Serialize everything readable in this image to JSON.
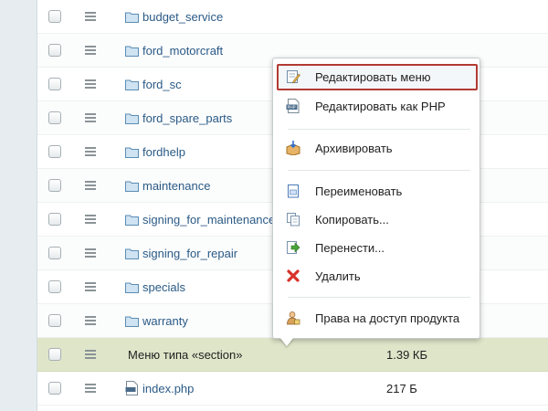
{
  "rows": [
    {
      "type": "folder",
      "name": "budget_service",
      "size": ""
    },
    {
      "type": "folder",
      "name": "ford_motorcraft",
      "size": ""
    },
    {
      "type": "folder",
      "name": "ford_sc",
      "size": ""
    },
    {
      "type": "folder",
      "name": "ford_spare_parts",
      "size": ""
    },
    {
      "type": "folder",
      "name": "fordhelp",
      "size": ""
    },
    {
      "type": "folder",
      "name": "maintenance",
      "size": ""
    },
    {
      "type": "folder",
      "name": "signing_for_maintenance",
      "size": ""
    },
    {
      "type": "folder",
      "name": "signing_for_repair",
      "size": ""
    },
    {
      "type": "folder",
      "name": "specials",
      "size": ""
    },
    {
      "type": "folder",
      "name": "warranty",
      "size": ""
    },
    {
      "type": "menu-file",
      "name": "Меню типа «section»",
      "size": "1.39 КБ"
    },
    {
      "type": "php-file",
      "name": "index.php",
      "size": "217 Б"
    }
  ],
  "context_menu": {
    "items": [
      {
        "label": "Редактировать меню",
        "icon": "edit-menu-icon"
      },
      {
        "label": "Редактировать как PHP",
        "icon": "php-icon"
      },
      {
        "label": "Архивировать",
        "icon": "archive-icon"
      },
      {
        "label": "Переименовать",
        "icon": "rename-icon"
      },
      {
        "label": "Копировать...",
        "icon": "copy-icon"
      },
      {
        "label": "Перенести...",
        "icon": "move-icon"
      },
      {
        "label": "Удалить",
        "icon": "delete-icon"
      },
      {
        "label": "Права на доступ продукта",
        "icon": "permissions-icon"
      }
    ]
  },
  "colors": {
    "link": "#2a5a86",
    "active_row": "#dfe5c9",
    "highlight_border": "#b23a32"
  }
}
